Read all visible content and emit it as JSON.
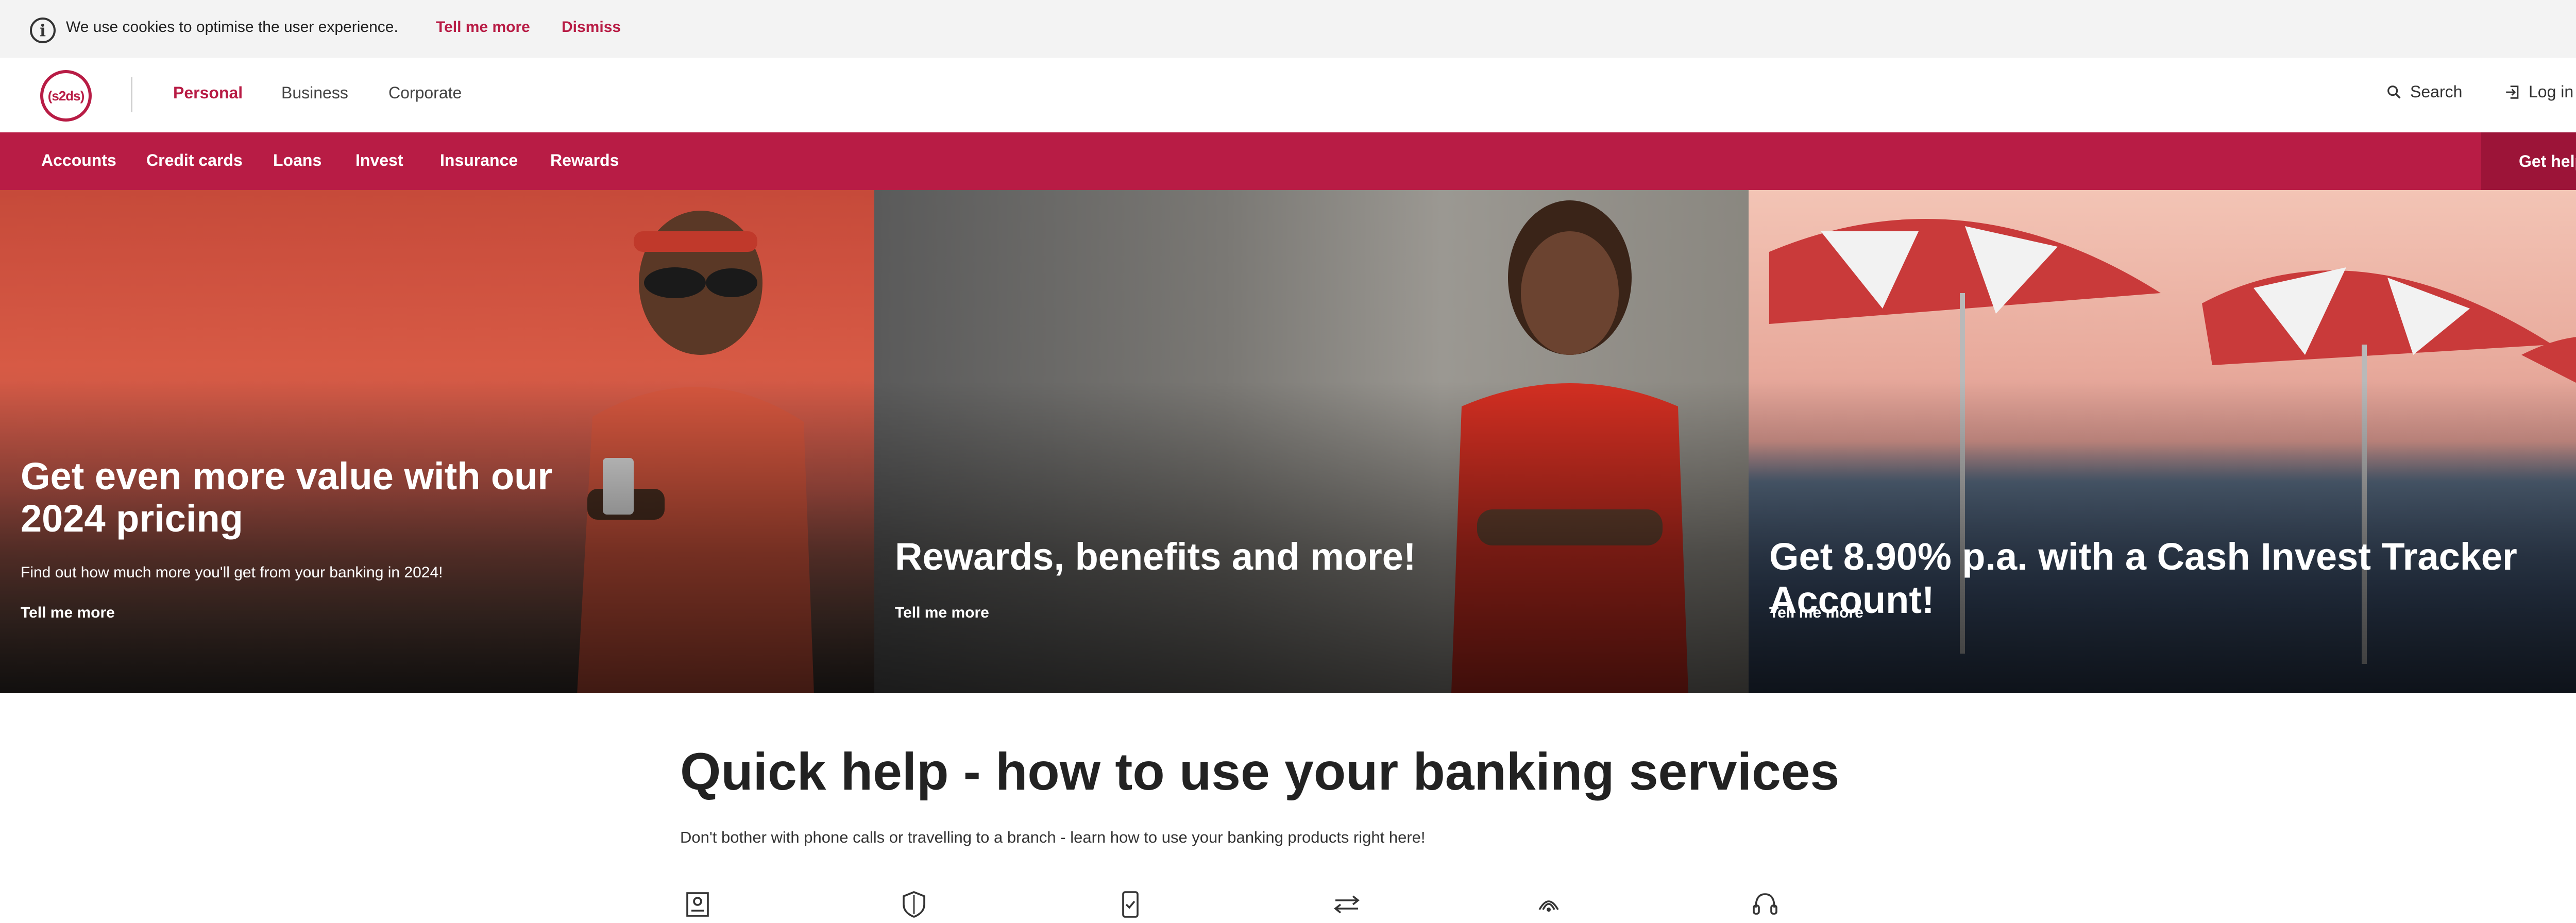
{
  "cookie_bar": {
    "message": "We use cookies to optimise the user experience.",
    "tell_me_more": "Tell me more",
    "dismiss": "Dismiss"
  },
  "header": {
    "logo_text": "(s2ds)",
    "segments": [
      "Personal",
      "Business",
      "Corporate"
    ],
    "active_segment": "Personal",
    "search_label": "Search",
    "login_label": "Log in"
  },
  "nav": {
    "items": [
      "Accounts",
      "Credit cards",
      "Loans",
      "Invest",
      "Insurance",
      "Rewards"
    ],
    "get_help": "Get help"
  },
  "hero": [
    {
      "title_line1": "Get even more value with our",
      "title_line2": "2024 pricing",
      "subtitle": "Find out how much more you'll get from your banking in 2024!",
      "link": "Tell me more"
    },
    {
      "title": "Rewards, benefits and more!",
      "link": "Tell me more"
    },
    {
      "title": "Get 8.90% p.a. with a Cash Invest Tracker Account!",
      "link": "Tell me more"
    }
  ],
  "quick_help": {
    "title": "Quick help - how to use your banking services",
    "subtitle": "Don't bother with phone calls or travelling to a branch - learn how to use your banking products right here!",
    "icons": [
      "id-card-icon",
      "shield-icon",
      "mobile-check-icon",
      "transfer-arrows-icon",
      "contactless-icon",
      "headset-icon"
    ]
  },
  "colors": {
    "brand": "#b81c45",
    "brand_dark": "#9c1438",
    "cookie_bg": "#f3f3f3"
  }
}
